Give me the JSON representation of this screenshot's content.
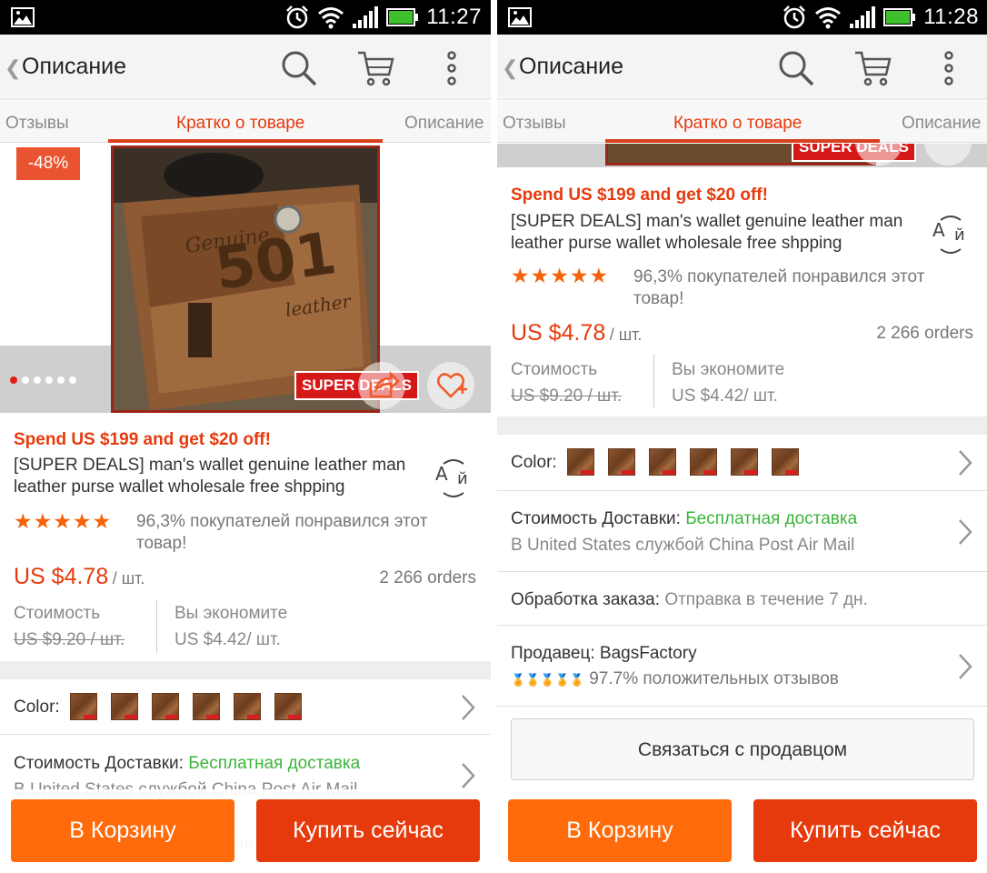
{
  "status_left": {
    "time": "11:27"
  },
  "status_right": {
    "time": "11:28"
  },
  "actionbar": {
    "back_glyph": "❮",
    "title": "Описание"
  },
  "tabs": [
    "Отзывы",
    "Кратко о товаре",
    "Описание"
  ],
  "image": {
    "discount": "-48%",
    "super_deals": "SUPER DEALS",
    "slide_count": 6,
    "active_slide": 1
  },
  "product": {
    "promo": "Spend US $199 and get $20 off!",
    "title": "[SUPER DEALS] man's wallet genuine leather man leather purse wallet wholesale free shpping",
    "stars": "★★★★★",
    "rating_text": "96,3% покупателей понравился этот товар!",
    "price": "US $4.78",
    "price_unit": "/ шт.",
    "orders": "2 266 orders",
    "cost_label": "Стоимость",
    "old_price": "US $9.20 / шт.",
    "save_label": "Вы экономите",
    "save_value": "US $4.42/ шт."
  },
  "rows": {
    "color_label": "Color:",
    "swatch_count": 6,
    "shipping_label": "Стоимость Доставки:",
    "shipping_value": "Бесплатная доставка",
    "shipping_sub": "В United States службой China Post Air Mail",
    "processing_label": "Обработка заказа:",
    "processing_value": "Отправка в течение 7 дн.",
    "seller_label": "Продавец:",
    "seller_name": "BagsFactory",
    "seller_medals": "🏅🏅🏅🏅🏅",
    "seller_feedback": "97.7% положительных отзывов",
    "contact_button": "Связаться с продавцом",
    "hidden_partial": "ав"
  },
  "buttons": {
    "add_to_cart": "В Корзину",
    "buy_now": "Купить сейчас"
  },
  "colors": {
    "accent": "#e63a0c",
    "cart_button": "#ff6a0a",
    "free_shipping": "#3bb53b"
  }
}
